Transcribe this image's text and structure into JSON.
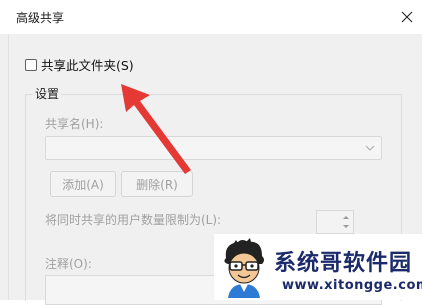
{
  "window": {
    "title": "高级共享"
  },
  "share_checkbox": {
    "label": "共享此文件夹(S)",
    "checked": false
  },
  "settings": {
    "group_title": "设置",
    "share_name_label": "共享名(H):",
    "share_name_value": "",
    "add_button": "添加(A)",
    "remove_button": "删除(R)",
    "limit_label": "将同时共享的用户数量限制为(L):",
    "limit_value": "",
    "comment_label": "注释(O):",
    "comment_value": ""
  },
  "watermark": {
    "title": "系统哥软件园",
    "url": "www.xitongge.com"
  },
  "colors": {
    "arrow": "#e53935",
    "disabled_text": "#a0a0a0",
    "watermark": "#1b2a6b"
  },
  "icons": [
    "close-icon",
    "chevron-down-icon",
    "spin-up-icon",
    "spin-down-icon",
    "annotation-arrow",
    "mascot-logo"
  ]
}
